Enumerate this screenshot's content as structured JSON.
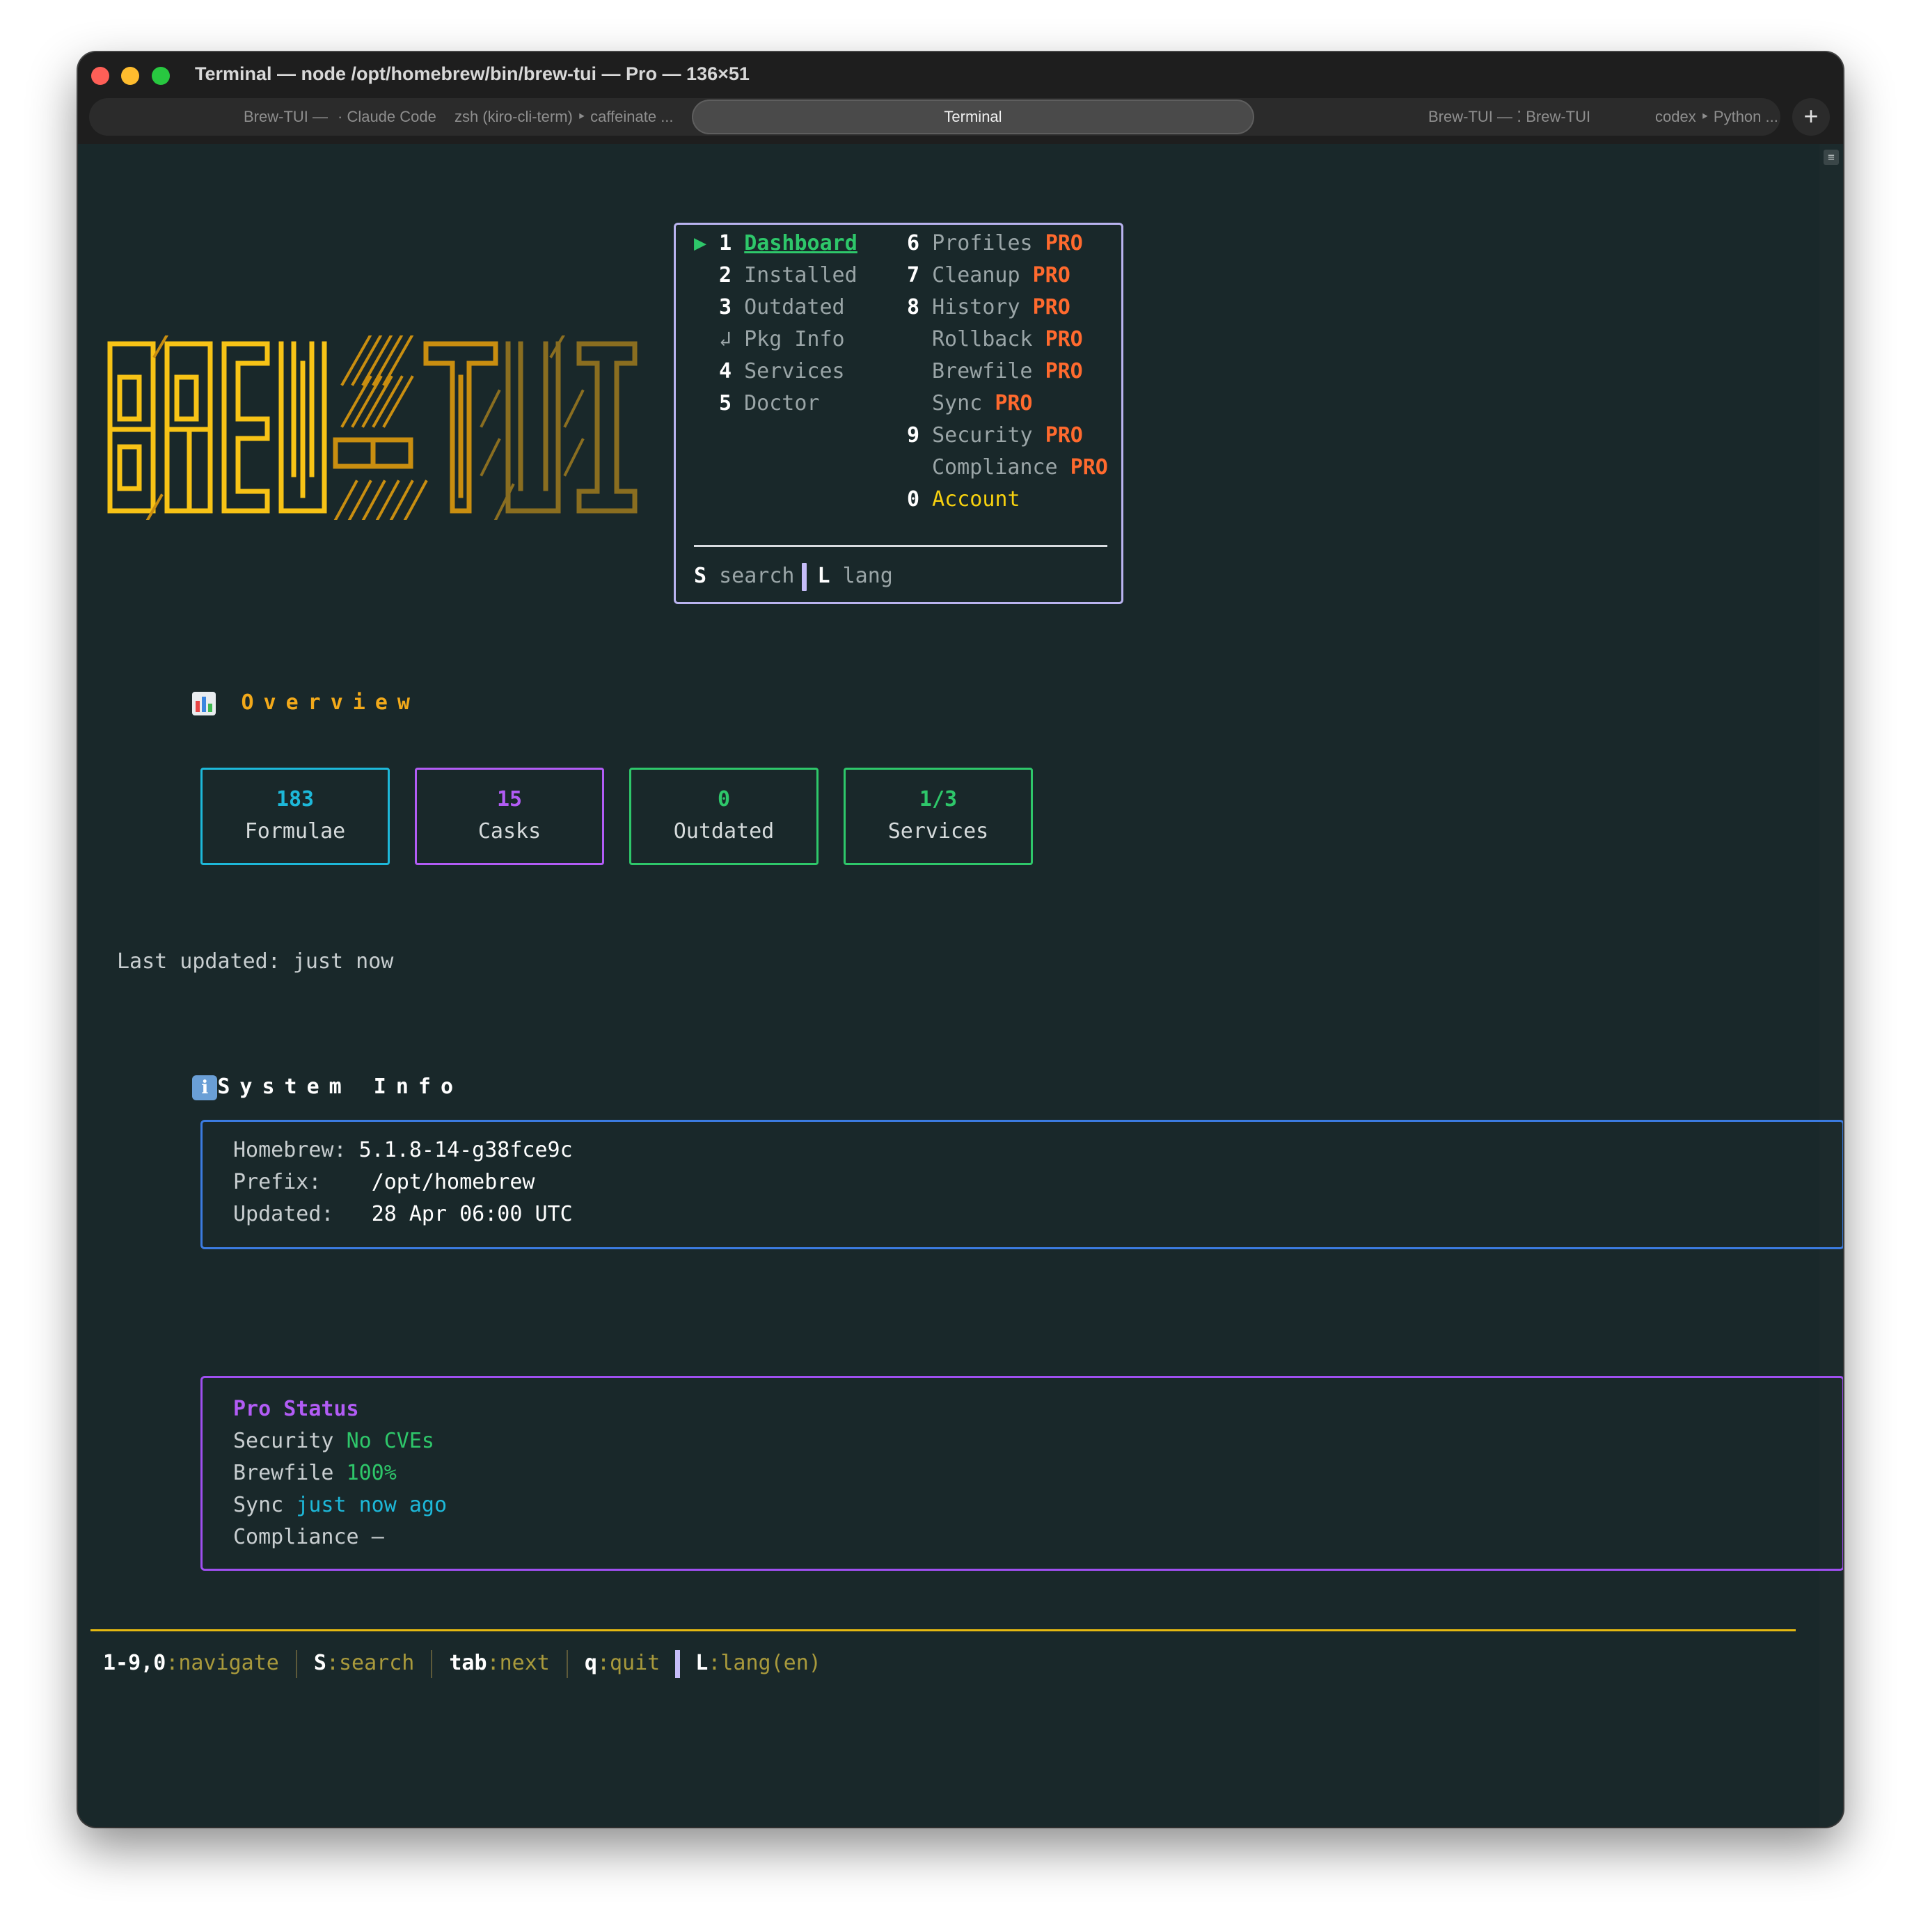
{
  "window": {
    "title": "Terminal — node /opt/homebrew/bin/brew-tui — Pro — 136×51",
    "tabs": [
      {
        "label": "Brew-TUI —"
      },
      {
        "label": "· Claude Code"
      },
      {
        "label": "zsh (kiro-cli-term) ‣ caffeinate ..."
      },
      {
        "label": "Terminal",
        "active": true
      },
      {
        "label": "Brew-TUI — ⁚ Brew-TUI"
      },
      {
        "label": "codex ‣ Python ..."
      }
    ],
    "new_tab": "+"
  },
  "logo": {
    "text": "BREW-TUI",
    "colors": [
      "#f7c316",
      "#c98e10",
      "#8a6e20"
    ]
  },
  "menu": {
    "selected_marker": "▶",
    "left": [
      {
        "key": "1",
        "label": "Dashboard",
        "selected": true
      },
      {
        "key": "2",
        "label": "Installed"
      },
      {
        "key": "3",
        "label": "Outdated"
      },
      {
        "key": "↲",
        "label": "Pkg Info"
      },
      {
        "key": "4",
        "label": "Services"
      },
      {
        "key": "5",
        "label": "Doctor"
      }
    ],
    "right": [
      {
        "key": "6",
        "label": "Profiles",
        "badge": "PRO"
      },
      {
        "key": "7",
        "label": "Cleanup",
        "badge": "PRO"
      },
      {
        "key": "8",
        "label": "History",
        "badge": "PRO"
      },
      {
        "key": "",
        "label": "Rollback",
        "badge": "PRO"
      },
      {
        "key": "",
        "label": "Brewfile",
        "badge": "PRO"
      },
      {
        "key": "",
        "label": "Sync",
        "badge": "PRO"
      },
      {
        "key": "9",
        "label": "Security",
        "badge": "PRO"
      },
      {
        "key": "",
        "label": "Compliance",
        "badge": "PRO"
      },
      {
        "key": "0",
        "label": "Account"
      }
    ],
    "bottom": {
      "search_key": "S",
      "search_label": "search",
      "lang_key": "L",
      "lang_label": "lang"
    }
  },
  "overview": {
    "title": "Overview",
    "stats": [
      {
        "value": "183",
        "label": "Formulae",
        "color": "#1db8d9"
      },
      {
        "value": "15",
        "label": "Casks",
        "color": "#b25cf5"
      },
      {
        "value": "0",
        "label": "Outdated",
        "color": "#2ec76a"
      },
      {
        "value": "1/3",
        "label": "Services",
        "color": "#2ec76a"
      }
    ],
    "last_updated": "Last updated: just now"
  },
  "system_info": {
    "title": "System Info",
    "rows": [
      {
        "label": "Homebrew:",
        "value": "5.1.8-14-g38fce9c"
      },
      {
        "label": "Prefix:",
        "value": "/opt/homebrew"
      },
      {
        "label": "Updated:",
        "value": "28 Apr 06:00 UTC"
      }
    ]
  },
  "pro_status": {
    "title": "Pro Status",
    "rows": [
      {
        "label": "Security",
        "value": "No CVEs",
        "color": "#2ec76a"
      },
      {
        "label": "Brewfile",
        "value": "100%",
        "color": "#2ec76a"
      },
      {
        "label": "Sync",
        "value": "just now ago",
        "color": "#1db8d9"
      },
      {
        "label": "Compliance",
        "value": "—",
        "color": "#c8ced0"
      }
    ]
  },
  "footer": {
    "nav_key": "1-9,0",
    "nav_label": ":navigate",
    "search_key": "S",
    "search_label": ":search",
    "tab_key": "tab",
    "tab_label": ":next",
    "quit_key": "q",
    "quit_label": ":quit",
    "lang_key": "L",
    "lang_label": ":lang(en)"
  }
}
